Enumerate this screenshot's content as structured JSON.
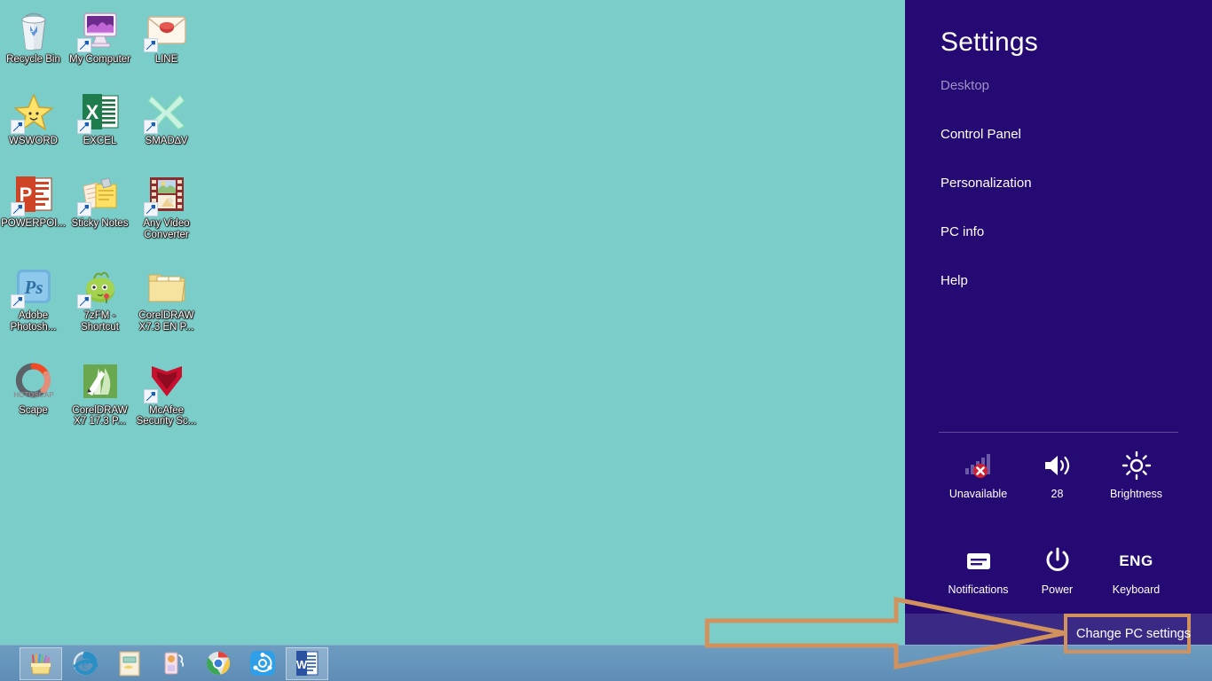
{
  "desktop": {
    "background_color": "#7acdc8",
    "icons": [
      {
        "label": "Recycle Bin",
        "art": "recycle-bin",
        "shortcut": false
      },
      {
        "label": "My Computer",
        "art": "my-computer",
        "shortcut": true
      },
      {
        "label": "LINE",
        "art": "line-envelope",
        "shortcut": true
      },
      {
        "label": "WSWORD",
        "art": "star",
        "shortcut": true
      },
      {
        "label": "EXCEL",
        "art": "excel",
        "shortcut": true
      },
      {
        "label": "SMAD∆V",
        "art": "smadav",
        "shortcut": true
      },
      {
        "label": "POWERPOI...",
        "art": "powerpoint",
        "shortcut": true
      },
      {
        "label": "Sticky Notes",
        "art": "sticky-notes",
        "shortcut": true
      },
      {
        "label": "Any Video Converter",
        "art": "any-video-converter",
        "shortcut": true
      },
      {
        "label": "Adobe Photosh...",
        "art": "photoshop",
        "shortcut": true
      },
      {
        "label": "7zFM - Shortcut",
        "art": "7zip",
        "shortcut": true
      },
      {
        "label": "CorelDRAW X7.3 EN P...",
        "art": "folder",
        "shortcut": false
      },
      {
        "label": "Scape",
        "art": "photoscape",
        "shortcut": false
      },
      {
        "label": "CorelDRAW X7 17.3 P...",
        "art": "coreldraw",
        "shortcut": false
      },
      {
        "label": "McAfee Security Sc...",
        "art": "mcafee",
        "shortcut": true
      }
    ]
  },
  "settings_pane": {
    "background_color": "#250a73",
    "title": "Settings",
    "links": [
      {
        "label": "Desktop",
        "dim": true
      },
      {
        "label": "Control Panel",
        "dim": false
      },
      {
        "label": "Personalization",
        "dim": false
      },
      {
        "label": "PC info",
        "dim": false
      },
      {
        "label": "Help",
        "dim": false
      }
    ],
    "quick_settings": [
      {
        "label": "Unavailable",
        "icon": "network-unavailable-icon"
      },
      {
        "label": "28",
        "icon": "volume-icon"
      },
      {
        "label": "Brightness",
        "icon": "brightness-icon"
      },
      {
        "label": "Notifications",
        "icon": "notifications-icon"
      },
      {
        "label": "Power",
        "icon": "power-icon"
      },
      {
        "label": "Keyboard",
        "icon": "keyboard-icon",
        "glyph_text": "ENG"
      }
    ],
    "change_pc_settings": "Change PC settings"
  },
  "annotation": {
    "color": "#d2925e",
    "callout_label": "Change PC settings",
    "shape": "right-arrow-outline"
  },
  "taskbar": {
    "background_color": "#6796bd",
    "items": [
      {
        "name": "crayon-box",
        "active": true
      },
      {
        "name": "internet-explorer",
        "active": false
      },
      {
        "name": "notepad-book",
        "active": false
      },
      {
        "name": "paint-tool",
        "active": false
      },
      {
        "name": "google-chrome",
        "active": false
      },
      {
        "name": "shareit",
        "active": false
      },
      {
        "name": "microsoft-word",
        "active": true
      }
    ]
  }
}
